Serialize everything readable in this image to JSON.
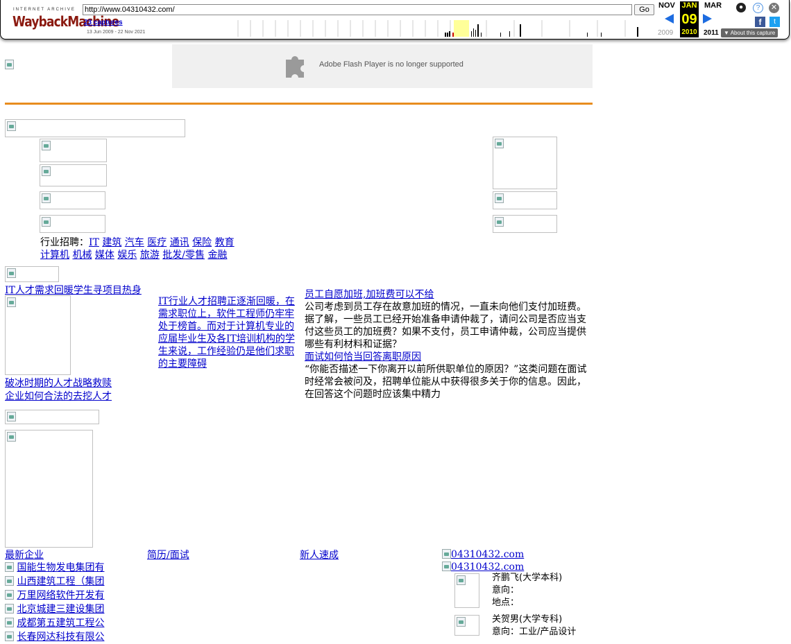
{
  "toolbar": {
    "logo_top": "INTERNET ARCHIVE",
    "logo_main": "WaybackMachine",
    "url": "http://www.04310432.com/",
    "go_label": "Go",
    "captures": "23 captures",
    "date_range": "13 Jun 2009 - 22 Nov 2021",
    "prev_month": "NOV",
    "cur_month": "JAN",
    "next_month": "MAR",
    "cur_day": "09",
    "prev_year": "2009",
    "cur_year": "2010",
    "next_year": "2011",
    "about": "About this capture",
    "accent": "#8b1a10",
    "highlight": "#ffff99"
  },
  "flash_notice": "Adobe Flash Player is no longer supported",
  "industry": {
    "prefix": "行业招聘：",
    "row1": [
      "IT",
      "建筑",
      "汽车",
      "医疗",
      "通讯",
      "保险",
      "教育"
    ],
    "row2": [
      "计算机",
      "机械",
      "媒体",
      "娱乐",
      "旅游",
      "批发/零售",
      "金融"
    ]
  },
  "news": {
    "headline": "IT人才需求回暖学生寻项目热身",
    "mid_link": "IT行业人才招聘正逐渐回暖，在需求职位上，软件工程师仍牢牢处于榜首。而对于计算机专业的应届毕业生及各IT培训机构的学生来说，工作经验仍是他们求职的主要障碍",
    "left_links": [
      "破冰时期的人才战略救赎",
      "企业如何合法的去挖人才"
    ],
    "articles": [
      {
        "title": "员工自愿加班,加班费可以不给",
        "body": "公司考虑到员工存在故意加班的情况，一直未向他们支付加班费。据了解，一些员工已经开始准备申请仲裁了，请问公司是否应当支付这些员工的加班费？如果不支付，员工申请仲裁，公司应当提供哪些有利材料和证据？"
      },
      {
        "title": "面试如何恰当回答离职原因",
        "body": "“你能否描述一下你离开以前所供职单位的原因？”这类问题在面试时经常会被问及，招聘单位能从中获得很多关于你的信息。因此，在回答这个问题时应该集中精力"
      }
    ]
  },
  "bottom": {
    "col_heads": [
      "最新企业",
      "简历/面试",
      "新人速成"
    ],
    "companies": [
      "国能生物发电集团有",
      "山西建筑工程（集团",
      "万里网络软件开发有",
      "北京城建三建设集团",
      "成都第五建筑工程公",
      "长春网达科技有限公"
    ],
    "site_alts": [
      "04310432.com",
      "04310432.com"
    ],
    "people": [
      {
        "name": "齐鹏飞(大学本科)",
        "intent": "意向：",
        "place": "地点："
      },
      {
        "name": "关贺男(大学专科)",
        "intent": "意向：工业/产品设计"
      }
    ]
  }
}
